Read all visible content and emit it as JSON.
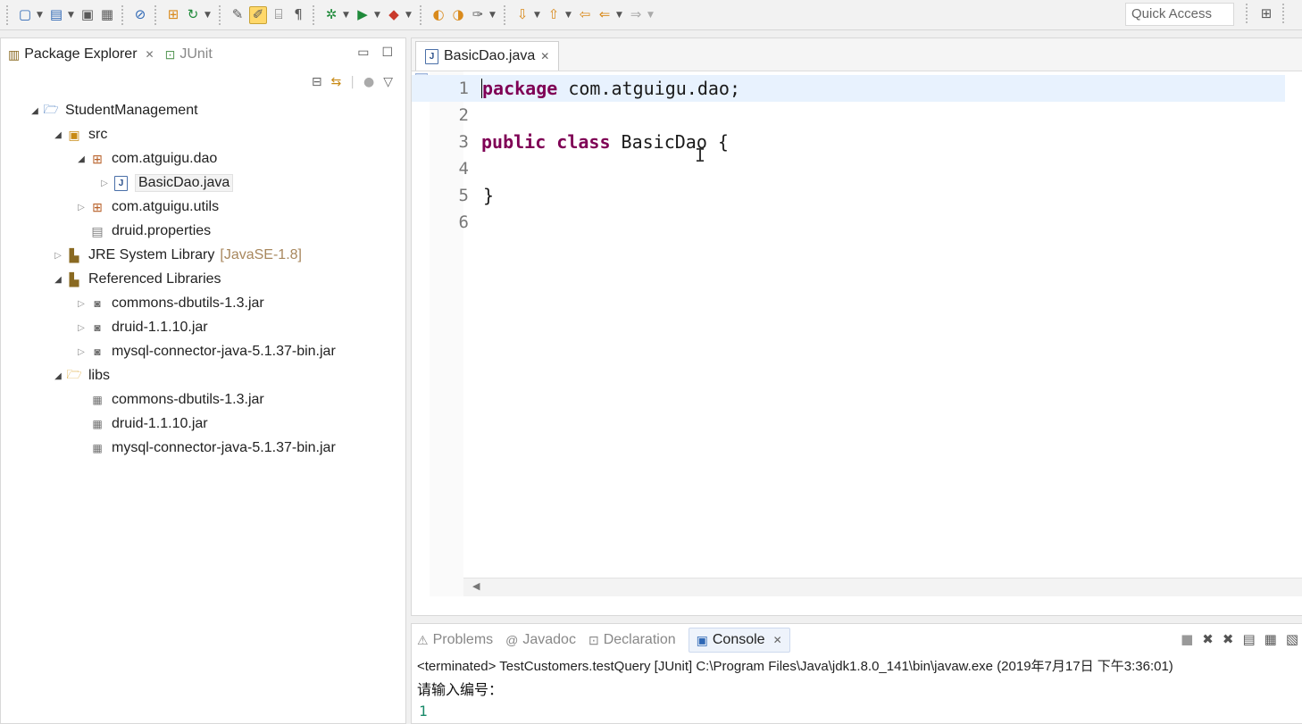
{
  "toolbar": {
    "icons": [
      "new-wizard-icon",
      "new-project-icon",
      "save-icon",
      "save-all-icon",
      "skip-breakpoints-icon",
      "new-java-package-icon",
      "refresh-icon",
      "toggle-mark-occurrences-icon",
      "toggle-highlight-icon",
      "toggle-block-selection-icon",
      "show-whitespace-icon",
      "debug-icon",
      "run-icon",
      "external-tools-icon",
      "open-type-icon",
      "open-task-icon",
      "search-icon",
      "next-annotation-icon",
      "previous-annotation-icon",
      "last-edit-icon",
      "back-icon",
      "forward-icon"
    ],
    "quick_access_label": "Quick Access"
  },
  "explorer": {
    "tabs": [
      {
        "label": "Package Explorer",
        "active": true
      },
      {
        "label": "JUnit",
        "active": false
      }
    ],
    "tree": [
      {
        "label": "StudentManagement",
        "depth": 0,
        "twisty": "open",
        "icon": "project"
      },
      {
        "label": "src",
        "depth": 1,
        "twisty": "open",
        "icon": "src"
      },
      {
        "label": "com.atguigu.dao",
        "depth": 2,
        "twisty": "open",
        "icon": "package"
      },
      {
        "label": "BasicDao.java",
        "depth": 3,
        "twisty": "closed",
        "icon": "java",
        "selected": true
      },
      {
        "label": "com.atguigu.utils",
        "depth": 2,
        "twisty": "closed",
        "icon": "package"
      },
      {
        "label": "druid.properties",
        "depth": 2,
        "twisty": "none",
        "icon": "properties"
      },
      {
        "label": "JRE System Library",
        "decoration": "[JavaSE-1.8]",
        "depth": 1,
        "twisty": "closed",
        "icon": "library"
      },
      {
        "label": "Referenced Libraries",
        "depth": 1,
        "twisty": "open",
        "icon": "library"
      },
      {
        "label": "commons-dbutils-1.3.jar",
        "depth": 2,
        "twisty": "closed",
        "icon": "jar"
      },
      {
        "label": "druid-1.1.10.jar",
        "depth": 2,
        "twisty": "closed",
        "icon": "jar"
      },
      {
        "label": "mysql-connector-java-5.1.37-bin.jar",
        "depth": 2,
        "twisty": "closed",
        "icon": "jar"
      },
      {
        "label": "libs",
        "depth": 1,
        "twisty": "open",
        "icon": "folder"
      },
      {
        "label": "commons-dbutils-1.3.jar",
        "depth": 2,
        "twisty": "none",
        "icon": "jar-file"
      },
      {
        "label": "druid-1.1.10.jar",
        "depth": 2,
        "twisty": "none",
        "icon": "jar-file"
      },
      {
        "label": "mysql-connector-java-5.1.37-bin.jar",
        "depth": 2,
        "twisty": "none",
        "icon": "jar-file"
      }
    ]
  },
  "editor": {
    "tab_label": "BasicDao.java",
    "lines": [
      {
        "n": "1",
        "kw": "package",
        "rest": " com.atguigu.dao;"
      },
      {
        "n": "2",
        "kw": "",
        "rest": ""
      },
      {
        "n": "3",
        "kw": "public class",
        "rest": " BasicDao {"
      },
      {
        "n": "4",
        "kw": "",
        "rest": ""
      },
      {
        "n": "5",
        "kw": "",
        "rest": "}"
      },
      {
        "n": "6",
        "kw": "",
        "rest": ""
      }
    ]
  },
  "console": {
    "tabs": [
      {
        "label": "Problems",
        "icon": "problems-icon",
        "active": false
      },
      {
        "label": "Javadoc",
        "icon": "javadoc-icon",
        "active": false
      },
      {
        "label": "Declaration",
        "icon": "declaration-icon",
        "active": false
      },
      {
        "label": "Console",
        "icon": "console-icon",
        "active": true
      }
    ],
    "status": "<terminated> TestCustomers.testQuery [JUnit] C:\\Program Files\\Java\\jdk1.8.0_141\\bin\\javaw.exe (2019年7月17日 下午3:36:01)",
    "output": "请输入编号：",
    "input": "1"
  },
  "colors": {
    "keyword": "#7f0055",
    "current_line": "#e8f2fe",
    "decoration": "#a8875d",
    "console_input": "#1a8a6a"
  }
}
